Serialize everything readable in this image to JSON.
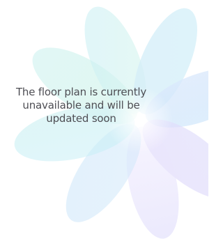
{
  "floor_plan_placeholder": {
    "message": "The floor plan is currently\nunavailable and will be\nupdated soon",
    "background_icon": "flower-petals-icon",
    "colors": {
      "background": "#ffffff",
      "text": "#4e4e54",
      "petal_cyan": "#bfeef4",
      "petal_mint": "#d9f5e8",
      "petal_blue": "#cfe2fb",
      "petal_violet": "#e4dcfb",
      "petal_lavender": "#f0ecfd"
    }
  }
}
